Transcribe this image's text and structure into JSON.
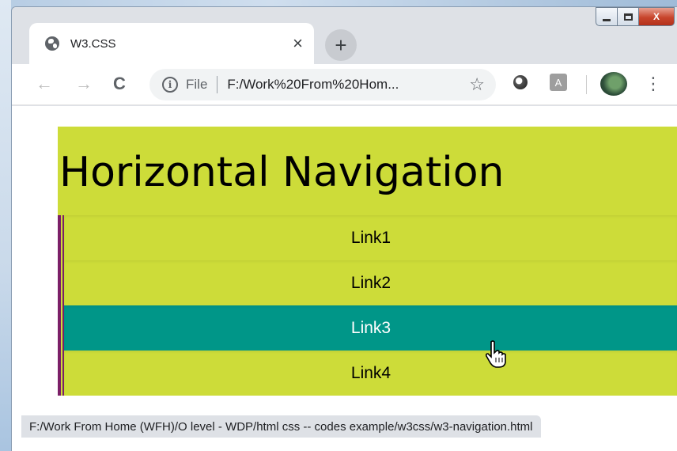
{
  "browser": {
    "tab_title": "W3.CSS",
    "tab_close": "×",
    "new_tab": "+",
    "window_controls": {
      "minimize": "",
      "maximize": "",
      "close": "X"
    },
    "nav": {
      "back": "←",
      "forward": "→",
      "reload": "C"
    },
    "omnibox": {
      "info": "i",
      "scheme_label": "File",
      "url": "F:/Work%20From%20Hom..."
    },
    "bookmark_star": "☆",
    "kebab": "⋮",
    "extension_pdf": "A"
  },
  "page": {
    "heading": "Horizontal Navigation",
    "links": [
      {
        "label": "Link1",
        "active": false
      },
      {
        "label": "Link2",
        "active": false
      },
      {
        "label": "Link3",
        "active": true
      },
      {
        "label": "Link4",
        "active": false
      }
    ]
  },
  "status_bar": {
    "text": "F:/Work From Home (WFH)/O level - WDP/html css -- codes example/w3css/w3-navigation.html"
  },
  "colors": {
    "lime": "#cddc39",
    "teal_active": "#009688",
    "border_purple": "#7b1f67"
  }
}
